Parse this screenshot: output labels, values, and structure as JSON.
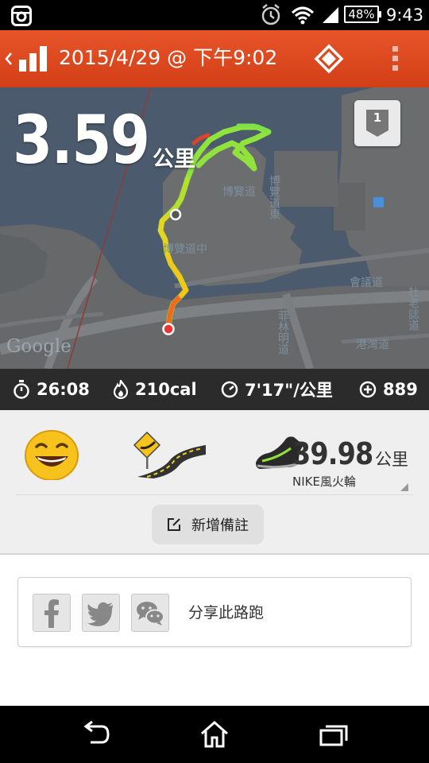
{
  "status_bar": {
    "battery": "48%",
    "time": "9:43",
    "icons": [
      "instagram-icon",
      "alarm-icon",
      "wifi-icon",
      "signal-icon",
      "battery-icon"
    ]
  },
  "action_bar": {
    "title": "2015/4/29 @ 下午9:02",
    "color": "#e04a1f",
    "icons": [
      "back-chevron-icon",
      "bar-chart-icon",
      "diamond-tag-icon",
      "overflow-menu-icon"
    ]
  },
  "map": {
    "distance": "3.59",
    "distance_unit": "公里",
    "mile_marker": "1",
    "labels": [
      "博覽道",
      "博覽道中",
      "博覽道東",
      "會議道",
      "港灣道",
      "菲林明道",
      "杜老誌道"
    ],
    "attribution": "Google"
  },
  "stats": {
    "duration": "26:08",
    "calories": "210cal",
    "pace": "7'17\"/公里",
    "fuel": "889"
  },
  "summary": {
    "shoe_distance": "39.98",
    "shoe_unit": "公里",
    "shoe_name": "NIKE風火輪",
    "add_note_label": "新增備註"
  },
  "share": {
    "label": "分享此路跑",
    "services": [
      "facebook-icon",
      "twitter-icon",
      "wechat-icon"
    ]
  }
}
